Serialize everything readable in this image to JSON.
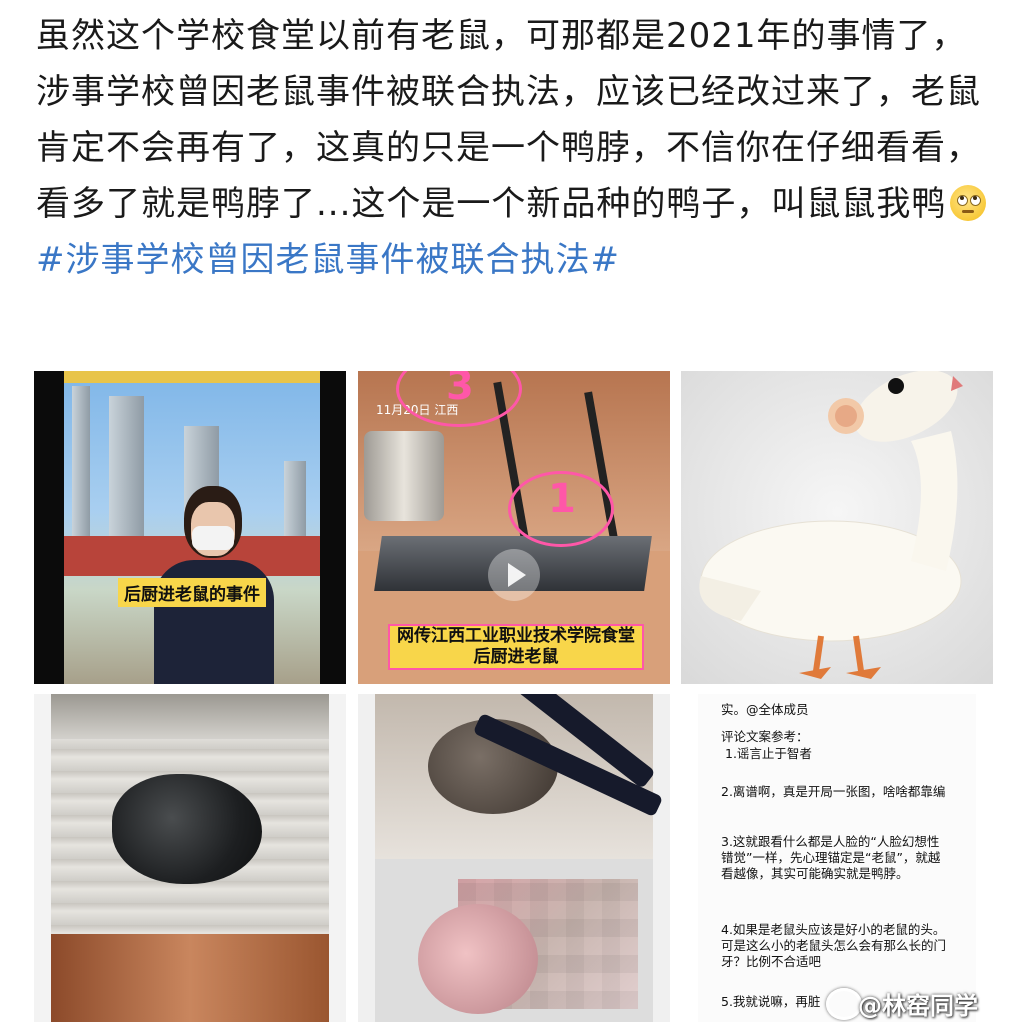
{
  "post": {
    "text": "虽然这个学校食堂以前有老鼠，可那都是2021年的事情了，涉事学校曾因老鼠事件被联合执法，应该已经改过来了，老鼠肯定不会再有了，这真的只是一个鸭脖，不信你在仔细看看，看多了就是鸭脖了...这个是一个新品种的鸭子，叫鼠鼠我鸭",
    "emoji": "eye-roll-emoji",
    "hashtag": "#涉事学校曾因老鼠事件被联合执法#"
  },
  "images": [
    {
      "caption": "后厨进老鼠的事件",
      "accent": "#f8d64a"
    },
    {
      "date": "11月20日 江西",
      "markers": [
        "1",
        "3"
      ],
      "caption_line1": "网传江西工业职业技术学院食堂",
      "caption_line2": "后厨进老鼠",
      "accent": "#ff57a8"
    },
    {
      "subject": "rat-headed duck figurine"
    },
    {
      "subject": "dark hairy lump on board"
    },
    {
      "subject": "chopsticks holding lump"
    },
    {
      "lines": [
        "实。@全体成员",
        "评论文案参考：",
        "1.谣言止于智者",
        "2.离谱啊，真是开局一张图，啥啥都靠编",
        "3.这就跟看什么都是人脸的“人脸幻想性错觉”一样，先心理锚定是“老鼠”，就越看越像，其实可能确实就是鸭脖。",
        "4.如果是老鼠头应该是好小的老鼠的头。可是这么小的老鼠头怎么会有那么长的门牙？比例不合适吧",
        "5.我就说嘛，再脏"
      ]
    }
  ],
  "watermark": "@林窑同学",
  "colors": {
    "hashtag": "#3a77c6",
    "text": "#1a1a1a"
  }
}
